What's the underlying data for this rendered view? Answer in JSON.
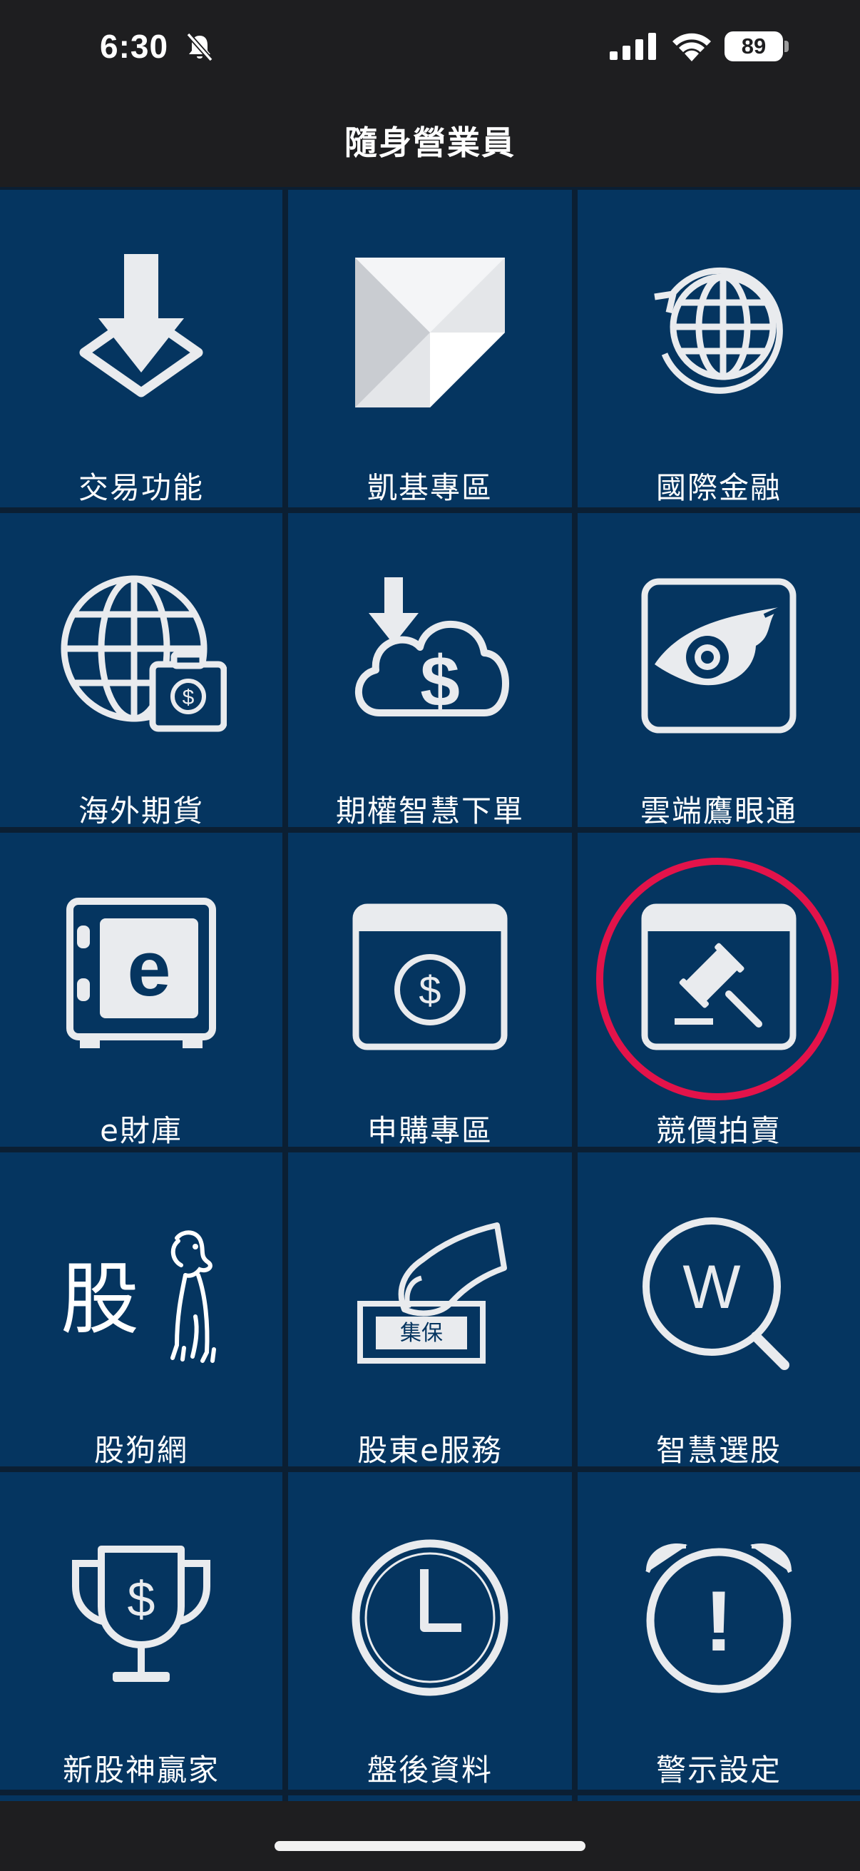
{
  "status_bar": {
    "time": "6:30",
    "battery": "89"
  },
  "header": {
    "title": "隨身營業員"
  },
  "tiles": [
    {
      "label": "交易功能",
      "icon": "download-tray-icon"
    },
    {
      "label": "凱基專區",
      "icon": "kgi-logo-icon"
    },
    {
      "label": "國際金融",
      "icon": "globe-refresh-icon"
    },
    {
      "label": "海外期貨",
      "icon": "globe-briefcase-icon"
    },
    {
      "label": "期權智慧下單",
      "icon": "cloud-dollar-download-icon"
    },
    {
      "label": "雲端鷹眼通",
      "icon": "eagle-eye-icon"
    },
    {
      "label": "e財庫",
      "icon": "safe-e-icon"
    },
    {
      "label": "申購專區",
      "icon": "window-dollar-icon"
    },
    {
      "label": "競價拍賣",
      "icon": "auction-gavel-icon"
    },
    {
      "label": "股狗網",
      "icon": "stock-dog-icon"
    },
    {
      "label": "股東e服務",
      "icon": "hand-ballot-icon"
    },
    {
      "label": "智慧選股",
      "icon": "search-w-icon"
    },
    {
      "label": "新股神贏家",
      "icon": "trophy-dollar-icon"
    },
    {
      "label": "盤後資料",
      "icon": "clock-icon"
    },
    {
      "label": "警示設定",
      "icon": "alarm-clock-icon"
    }
  ],
  "icon_text": {
    "e": "e",
    "dollar": "$",
    "w": "W",
    "gu": "股",
    "jibao": "集保",
    "exclaim": "!"
  },
  "colors": {
    "tile": "#053560",
    "highlight": "#e3134a",
    "bar": "#1e1e20"
  }
}
